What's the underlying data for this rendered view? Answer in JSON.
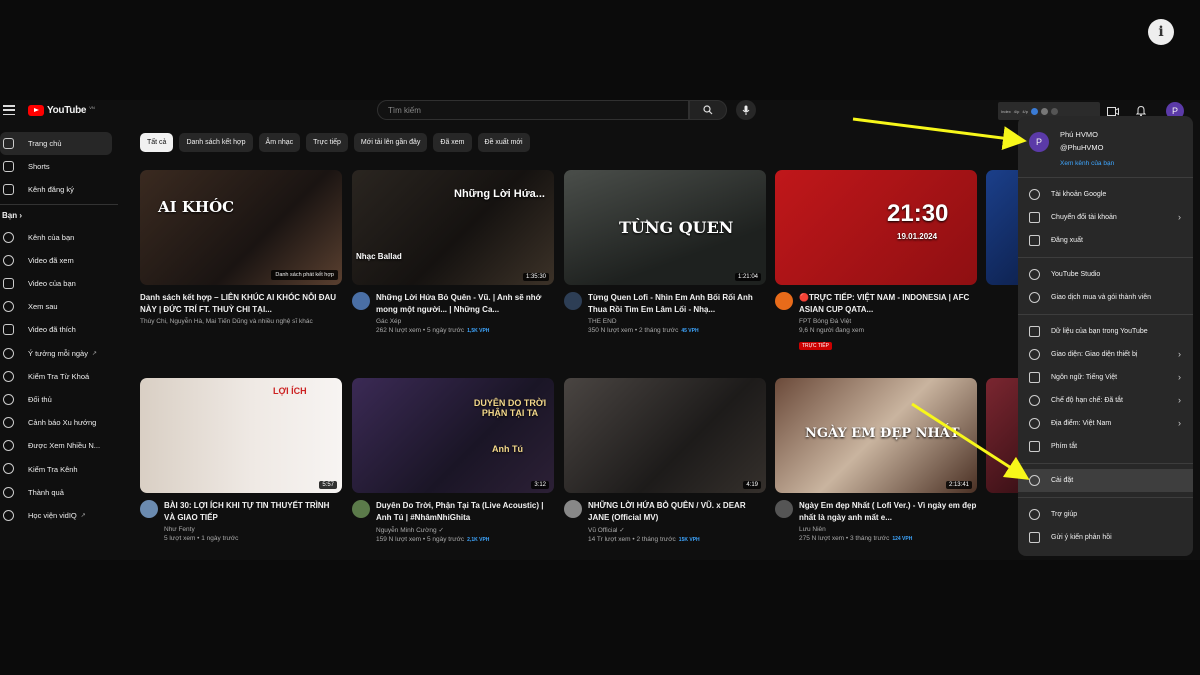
{
  "header": {
    "logo_text": "YouTube",
    "logo_sup": "VN",
    "search_placeholder": "Tìm kiếm",
    "avatar_letter": "P",
    "extension_labels": [
      "Index",
      "4/p",
      "4/p"
    ]
  },
  "sidebar": {
    "items_top": [
      {
        "label": "Trang chủ",
        "icon": "home-icon",
        "active": true
      },
      {
        "label": "Shorts",
        "icon": "shorts-icon"
      },
      {
        "label": "Kênh đăng ký",
        "icon": "subscriptions-icon"
      }
    ],
    "section_title": "Bạn",
    "items_you": [
      {
        "label": "Kênh của bạn",
        "icon": "channel-icon"
      },
      {
        "label": "Video đã xem",
        "icon": "history-icon"
      },
      {
        "label": "Video của bạn",
        "icon": "your-videos-icon"
      },
      {
        "label": "Xem sau",
        "icon": "watch-later-icon"
      },
      {
        "label": "Video đã thích",
        "icon": "liked-icon"
      },
      {
        "label": "Ý tưởng mỗi ngày",
        "icon": "idea-icon",
        "ext": true
      },
      {
        "label": "Kiểm Tra Từ Khoá",
        "icon": "keyword-icon"
      },
      {
        "label": "Đối thủ",
        "icon": "competitor-icon"
      },
      {
        "label": "Cảnh báo Xu hướng",
        "icon": "trend-icon"
      },
      {
        "label": "Được Xem Nhiều N...",
        "icon": "most-viewed-icon"
      },
      {
        "label": "Kiểm Tra Kênh",
        "icon": "channel-check-icon"
      },
      {
        "label": "Thành quả",
        "icon": "achievement-icon"
      },
      {
        "label": "Học viện vidIQ",
        "icon": "academy-icon",
        "ext": true
      }
    ]
  },
  "chips": [
    "Tất cả",
    "Danh sách kết hợp",
    "Âm nhạc",
    "Trực tiếp",
    "Mới tải lên gần đây",
    "Đã xem",
    "Đề xuất mới"
  ],
  "videos": [
    {
      "title": "Danh sách kết hợp – LIÊN KHÚC AI KHÓC NỖI ĐAU NÀY | ĐỨC TRÍ FT. THUỲ CHI TẠI...",
      "channel": "Thùy Chi, Nguyễn Hà, Mai Tiến Dũng và nhiều nghệ sĩ khác",
      "stats": "",
      "vph": "",
      "duration": "",
      "overlay": "AI KHÓC",
      "badge": "Danh sách phát kết hợp"
    },
    {
      "title": "Những Lời Hứa Bỏ Quên - Vũ. | Anh sẽ nhớ mong một người... | Những Ca...",
      "channel": "Gác Xép",
      "stats": "262 N lượt xem • 5 ngày trước",
      "vph": "1,5K VPH",
      "duration": "1:35:30",
      "overlay": "Những Lời Hứa...",
      "overlay2": "Nhạc Ballad"
    },
    {
      "title": "Từng Quen Lofi - Nhìn Em Anh Bối Rối Anh Thua Rồi Tìm Em Lâm Lối - Nhạ...",
      "channel": "THE END",
      "stats": "350 N lượt xem • 2 tháng trước",
      "vph": "45 VPH",
      "duration": "1:21:04",
      "overlay": "TỪNG QUEN"
    },
    {
      "title": "🔴TRỰC TIẾP: VIỆT NAM - INDONESIA | AFC ASIAN CUP QATA...",
      "channel": "FPT Bóng Đá Việt",
      "stats": "9,6 N người đang xem",
      "vph": "",
      "duration": "",
      "overlay": "21:30",
      "overlay2": "19.01.2024",
      "live": "TRỰC TIẾP"
    },
    {
      "title": "BÀI 30: LỢI ÍCH KHI TỰ TIN THUYẾT TRÌNH VÀ GIAO TIẾP",
      "channel": "Như Fenty",
      "stats": "5 lượt xem • 1 ngày trước",
      "vph": "",
      "duration": "5:57",
      "overlay": "LỢI ÍCH"
    },
    {
      "title": "Duyên Do Trời, Phận Tại Ta (Live Acoustic) | Anh Tú | #NhâmNhiGhita",
      "channel": "Nguyễn Minh Cường ✓",
      "stats": "159 N lượt xem • 5 ngày trước",
      "vph": "2,1K VPH",
      "duration": "3:12",
      "overlay": "DUYÊN DO TRỜI PHẬN TẠI TA",
      "overlay2": "Anh Tú"
    },
    {
      "title": "NHỮNG LỜI HỨA BỎ QUÊN / VŨ. x DEAR JANE (Official MV)",
      "channel": "Vũ Official ✓",
      "stats": "14 Tr lượt xem • 2 tháng trước",
      "vph": "15K VPH",
      "duration": "4:19",
      "overlay": ""
    },
    {
      "title": "Ngày Em đẹp Nhất ( Lofi Ver.) - Vì ngày em đẹp nhất là ngày anh mất e...",
      "channel": "Lưu Niên",
      "stats": "275 N lượt xem • 3 tháng trước",
      "vph": "124 VPH",
      "duration": "2:13:41",
      "overlay": "NGÀY EM ĐẸP NHẤT"
    }
  ],
  "menu": {
    "name": "Phú HVMO",
    "handle": "@PhuHVMO",
    "channel_link": "Xem kênh của bạn",
    "groups": [
      [
        {
          "label": "Tài khoản Google",
          "icon": "google-icon"
        },
        {
          "label": "Chuyển đổi tài khoản",
          "icon": "switch-account-icon",
          "chevron": true
        },
        {
          "label": "Đăng xuất",
          "icon": "sign-out-icon"
        }
      ],
      [
        {
          "label": "YouTube Studio",
          "icon": "studio-icon"
        },
        {
          "label": "Giao dịch mua và gói thành viên",
          "icon": "purchases-icon"
        }
      ],
      [
        {
          "label": "Dữ liệu của bạn trong YouTube",
          "icon": "your-data-icon"
        },
        {
          "label": "Giao diện: Giao diện thiết bị",
          "icon": "appearance-icon",
          "chevron": true
        },
        {
          "label": "Ngôn ngữ: Tiếng Việt",
          "icon": "language-icon",
          "chevron": true
        },
        {
          "label": "Chế độ hạn chế: Đã tắt",
          "icon": "restricted-icon",
          "chevron": true
        },
        {
          "label": "Địa điểm: Việt Nam",
          "icon": "location-icon",
          "chevron": true
        },
        {
          "label": "Phím tắt",
          "icon": "keyboard-icon"
        }
      ],
      [
        {
          "label": "Cài đặt",
          "icon": "settings-icon",
          "hover": true
        }
      ],
      [
        {
          "label": "Trợ giúp",
          "icon": "help-icon"
        },
        {
          "label": "Gửi ý kiến phản hồi",
          "icon": "feedback-icon"
        }
      ]
    ]
  },
  "colors": {
    "accent_red": "#ff0000",
    "link_blue": "#3ea6ff",
    "arrow_yellow": "#f7f71a",
    "menu_bg": "#282828"
  }
}
